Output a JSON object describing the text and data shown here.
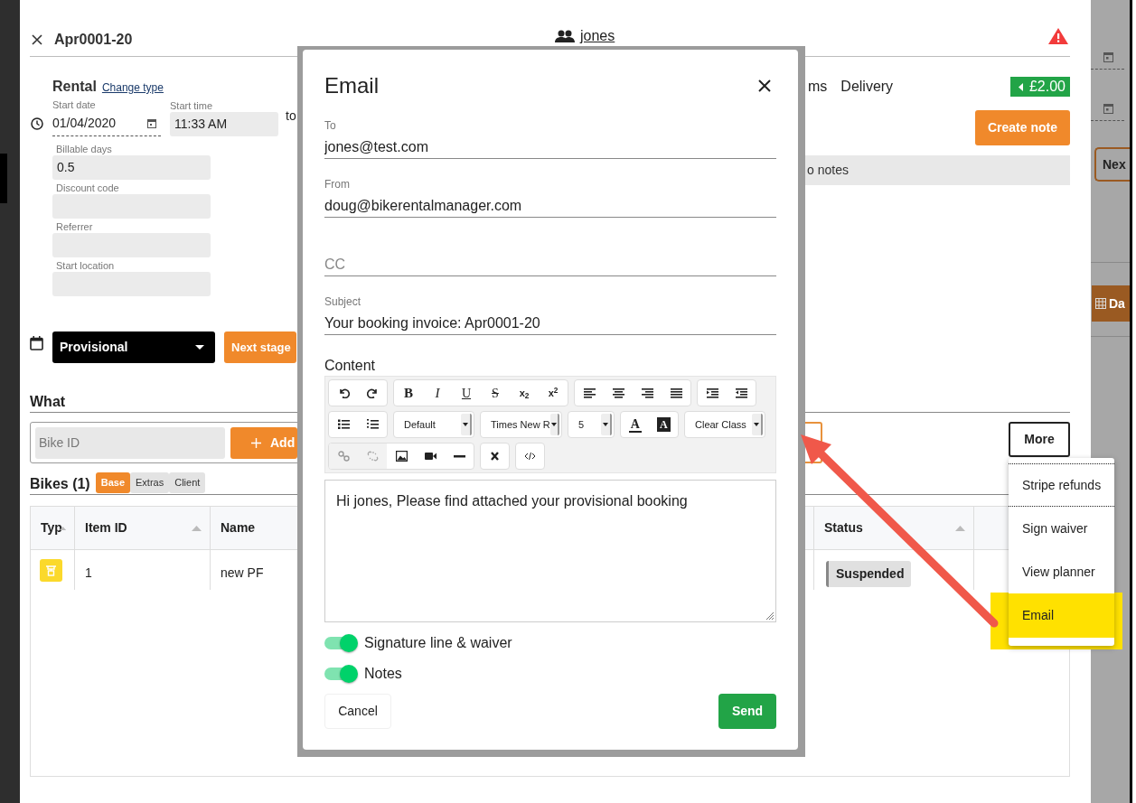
{
  "page": {
    "title": "Apr0001-20",
    "customer": "jones"
  },
  "booking": {
    "type": "Rental",
    "change_type": "Change type",
    "start_date_label": "Start date",
    "start_date": "01/04/2020",
    "start_time_label": "Start time",
    "start_time": "11:33 AM",
    "to": "to"
  },
  "fields": [
    {
      "label": "Billable days",
      "value": "0.5"
    },
    {
      "label": "Discount code"
    },
    {
      "label": "Referrer"
    },
    {
      "label": "Start location"
    }
  ],
  "tabs": [
    {
      "label": "ms",
      "selected": false
    },
    {
      "label": "Delivery",
      "selected": false
    }
  ],
  "balance": "£2.00",
  "create_note": "Create note",
  "notes": "o notes",
  "stage": {
    "value": "Provisional",
    "next": "Next stage"
  },
  "what": {
    "heading": "What",
    "placeholder": "Bike ID",
    "add": "Add",
    "more": "More"
  },
  "bikes": {
    "heading": "Bikes (1)",
    "views": [
      {
        "label": "Base",
        "selected": true
      },
      {
        "label": "Extras",
        "selected": false
      },
      {
        "label": "Client",
        "selected": false
      }
    ],
    "columns": [
      "Typ",
      "Item ID",
      "Name",
      "Status"
    ],
    "rows": [
      {
        "item_id": "1",
        "name": "new PF",
        "status": "Suspended"
      }
    ]
  },
  "menu": [
    {
      "label": "Stripe refunds",
      "highlighted": false
    },
    {
      "label": "Sign waiver",
      "highlighted": false
    },
    {
      "label": "View planner",
      "highlighted": false
    },
    {
      "label": "Email",
      "highlighted": true
    }
  ],
  "background": {
    "next": "Nex",
    "days": "Da"
  },
  "email": {
    "title": "Email",
    "fields": [
      {
        "label": "To",
        "value": "jones@test.com"
      },
      {
        "label": "From",
        "value": "doug@bikerentalmanager.com"
      },
      {
        "placeholder": "CC"
      },
      {
        "label": "Subject",
        "value": "Your booking invoice: Apr0001-20"
      }
    ],
    "content_label": "Content",
    "format": [
      "B",
      "I",
      "U",
      "S",
      "x$_{2}$",
      "x$^{2}$"
    ],
    "selects": [
      "Default",
      "Times New R",
      "5"
    ],
    "colors": [
      "A",
      "A"
    ],
    "clear_class": "Clear Class",
    "body": "Hi jones, Please find attached your provisional booking",
    "toggles": [
      {
        "label": "Signature line & waiver",
        "on": true
      },
      {
        "label": "Notes",
        "on": true
      }
    ],
    "cancel": "Cancel",
    "send": "Send"
  }
}
